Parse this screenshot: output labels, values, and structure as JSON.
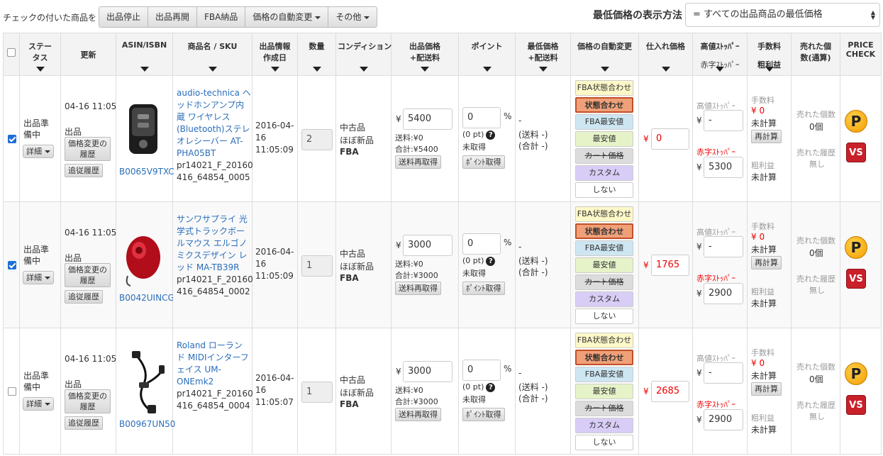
{
  "toolbar": {
    "label": "チェックの付いた商品を",
    "buttons": [
      "出品停止",
      "出品再開",
      "FBA納品",
      "価格の自動変更",
      "その他"
    ],
    "price_display_label": "最低価格の表示方法",
    "price_display_value": "= すべての出品商品の最低価格"
  },
  "columns": [
    "ステータス",
    "更新",
    "ASIN/ISBN",
    "商品名 / SKU",
    "出品情報作成日",
    "数量",
    "コンディション",
    "出品価格+配送料",
    "ポイント",
    "最低価格+配送料",
    "価格の自動変更",
    "仕入れ価格",
    "高値ｽﾄｯﾊﾟｰ",
    "赤字ｽﾄｯﾊﾟｰ",
    "手数料",
    "粗利益",
    "売れた個数(通算)",
    "PRICE CHECK"
  ],
  "common": {
    "detail": "詳細",
    "price_history_1": "価格変更の",
    "price_history_2": "履歴",
    "follow_history": "追従履歴",
    "listing_label": "出品",
    "shipping_refetch": "送料再取得",
    "point_refetch": "ﾎﾟｲﾝﾄ取得",
    "point_status": "未取得",
    "lowest_dash": "-",
    "lowest_ship": "(送料 -)",
    "lowest_total": "(合計 -)",
    "auto_options": [
      "FBA状態合わせ",
      "状態合わせ",
      "FBA最安値",
      "最安値",
      "カート価格",
      "カスタム",
      "しない"
    ],
    "high_stopper_label": "高値ｽﾄｯﾊﾟｰ",
    "high_stopper_value": "-",
    "red_stopper_label": "赤字ｽﾄｯﾊﾟｰ",
    "fee_label": "手数料",
    "fee_value": "¥ 0",
    "uncalc": "未計算",
    "recalc": "再計算",
    "profit_label": "粗利益",
    "sold_label": "売れた個数",
    "sold_value": "0個",
    "sold_history_label": "売れた履歴",
    "sold_history_value": "無し",
    "yen": "¥",
    "percent": "%",
    "check_icon_1": "P",
    "check_icon_2": "VS"
  },
  "rows": [
    {
      "checked": true,
      "status": [
        "出品準",
        "備中"
      ],
      "updated": "04-16 11:05",
      "asin": "B0065V9TXC",
      "name": [
        "audio-technica ヘ",
        "ッドホンアンプ内",
        "蔵 ワイヤレス",
        "(Bluetooth)ステレ",
        "オレシーバー AT-",
        "PHA05BT"
      ],
      "sku": [
        "pr14021_F_20160",
        "416_64854_0005"
      ],
      "created": [
        "2016-04-",
        "16",
        "11:05:09"
      ],
      "qty": "2",
      "condition": [
        "中古品",
        "ほぼ新品",
        "FBA"
      ],
      "price": "5400",
      "ship": "送料:¥0",
      "total": "合計:¥5400",
      "point": "0",
      "point_pt": "(0 pt)",
      "cost": "0",
      "red_stopper": "5300",
      "image": "headphone-amp"
    },
    {
      "checked": true,
      "status": [
        "出品準",
        "備中"
      ],
      "updated": "04-16 11:05",
      "asin": "B0042UINCG",
      "name": [
        "サンワサプライ 光",
        "学式トラックボー",
        "ルマウス エルゴノ",
        "ミクスデザイン レ",
        "ッド MA-TB39R"
      ],
      "sku": [
        "pr14021_F_20160",
        "416_64854_0002"
      ],
      "created": [
        "2016-04-",
        "16",
        "11:05:09"
      ],
      "qty": "1",
      "condition": [
        "中古品",
        "ほぼ新品",
        "FBA"
      ],
      "price": "3000",
      "ship": "送料:¥0",
      "total": "合計:¥3000",
      "point": "0",
      "point_pt": "(0 pt)",
      "cost": "1765",
      "red_stopper": "2900",
      "image": "trackball-mouse"
    },
    {
      "checked": false,
      "status": [
        "出品準",
        "備中"
      ],
      "updated": "04-16 11:05",
      "asin": "B00967UN50",
      "name": [
        "Roland ローラン",
        "ド MIDIインターフ",
        "ェイス UM-",
        "ONEmk2"
      ],
      "sku": [
        "pr14021_F_20160",
        "416_64854_0004"
      ],
      "created": [
        "2016-04-",
        "16",
        "11:05:07"
      ],
      "qty": "1",
      "condition": [
        "中古品",
        "ほぼ新品",
        "FBA"
      ],
      "price": "3000",
      "ship": "送料:¥0",
      "total": "合計:¥3000",
      "point": "0",
      "point_pt": "(0 pt)",
      "cost": "2685",
      "red_stopper": "2900",
      "image": "midi-cable"
    }
  ]
}
